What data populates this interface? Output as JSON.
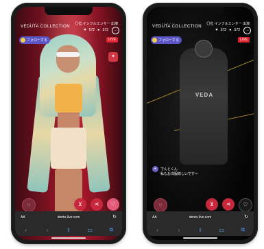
{
  "phones": [
    {
      "brand": "VEDUTA COLLECTION",
      "ranking": "〇位 インフルエンサー 出演",
      "viewer_count": "572",
      "comment_count": "572",
      "follow_label": "フォローする",
      "live_label": "LIVE",
      "url": "dento-live.com",
      "aa": "AA",
      "icons": {
        "viewers": "heart-icon",
        "comments": "chat-icon",
        "more": "more-icon",
        "cart": "cart-icon",
        "share": "share-icon",
        "like": "heart-icon",
        "gift": "gift-icon"
      },
      "nav": {
        "back": "‹",
        "forward": "›",
        "share": "⇪",
        "bookmarks": "▭",
        "tabs": "⧉"
      },
      "live_color": "#e02431"
    },
    {
      "brand": "VEDUTA COLLECTION",
      "ranking": "〇位 インフルエンサー 出演",
      "viewer_count": "572",
      "comment_count": "572",
      "follow_label": "フォローする",
      "live_label": "LIVE",
      "url": "dento-live.com",
      "aa": "AA",
      "chat_user": "でんとくん",
      "chat_message": "私もお洋服欲しいです〜",
      "shirt_text": "VEDA",
      "icons": {
        "viewers": "heart-icon",
        "comments": "chat-icon",
        "more": "more-icon",
        "cart": "cart-icon",
        "share": "share-icon"
      },
      "nav": {
        "back": "‹",
        "forward": "›",
        "share": "⇪",
        "bookmarks": "▭",
        "tabs": "⧉"
      }
    }
  ]
}
